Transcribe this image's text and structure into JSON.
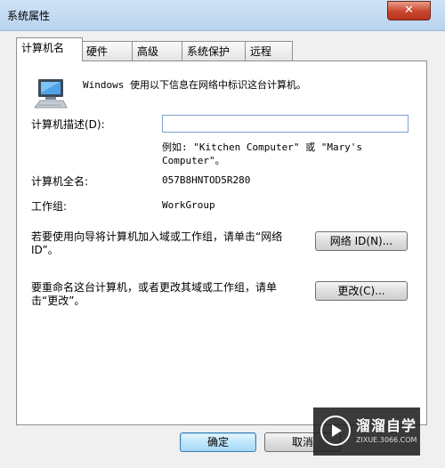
{
  "window": {
    "title": "系统属性",
    "close_symbol": "✕"
  },
  "tabs": [
    {
      "label": "计算机名",
      "active": true
    },
    {
      "label": "硬件",
      "active": false
    },
    {
      "label": "高级",
      "active": false
    },
    {
      "label": "系统保护",
      "active": false
    },
    {
      "label": "远程",
      "active": false
    }
  ],
  "computer_name": {
    "intro": "Windows 使用以下信息在网络中标识这台计算机。",
    "description_label": "计算机描述(D):",
    "description_value": "",
    "example": "例如: \"Kitchen Computer\" 或 \"Mary's Computer\"。",
    "full_name_label": "计算机全名:",
    "full_name_value": "057B8HNTOD5R280",
    "workgroup_label": "工作组:",
    "workgroup_value": "WorkGroup",
    "network_text": "若要使用向导将计算机加入域或工作组，请单击“网络 ID”。",
    "network_button": "网络 ID(N)...",
    "rename_text": "要重命名这台计算机，或者更改其域或工作组，请单击“更改”。",
    "change_button": "更改(C)..."
  },
  "footer": {
    "ok": "确定",
    "cancel": "取消"
  },
  "watermark": {
    "name": "溜溜自学",
    "site": "ZIXUE.3066.COM"
  }
}
